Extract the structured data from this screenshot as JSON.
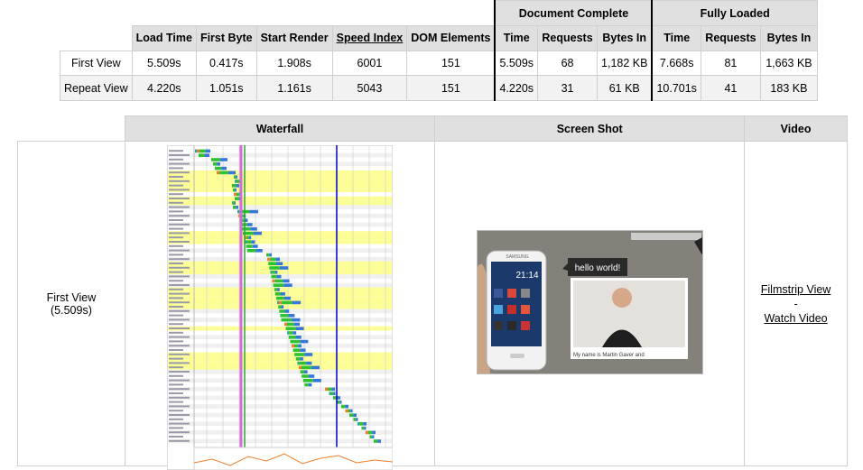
{
  "summary": {
    "groups": {
      "document_complete": "Document Complete",
      "fully_loaded": "Fully Loaded"
    },
    "headers": [
      "Load Time",
      "First Byte",
      "Start Render",
      "Speed Index",
      "DOM Elements",
      "Time",
      "Requests",
      "Bytes In",
      "Time",
      "Requests",
      "Bytes In"
    ],
    "rows": [
      {
        "label": "First View",
        "cells": [
          "5.509s",
          "0.417s",
          "1.908s",
          "6001",
          "151",
          "5.509s",
          "68",
          "1,182 KB",
          "7.668s",
          "81",
          "1,663 KB"
        ]
      },
      {
        "label": "Repeat View",
        "cells": [
          "4.220s",
          "1.051s",
          "1.161s",
          "5043",
          "151",
          "4.220s",
          "31",
          "61 KB",
          "10.701s",
          "41",
          "183 KB"
        ]
      }
    ]
  },
  "details": {
    "headers": {
      "waterfall": "Waterfall",
      "screenshot": "Screen Shot",
      "video": "Video"
    },
    "row_label": "First View",
    "row_sublabel": "(5.509s)",
    "filmstrip_link": "Filmstrip View",
    "separator": "-",
    "watch_video_link": "Watch Video"
  },
  "screenshot": {
    "speech_bubble": "hello world!",
    "caption": "My name is Martin Gaver and",
    "phone_time": "21:14",
    "phone_brand": "SAMSUNG"
  },
  "colors": {
    "header_bg": "#e0e0e0",
    "alt_row": "#f2f2f2",
    "highlight_row": "#fdfd96",
    "start_render_line": "#2aa52a",
    "doc_complete_line": "#0000cc",
    "dom_loaded_line": "#d66ad6",
    "dns": "#2aa5a5",
    "connect": "#f07f2a",
    "ttfb": "#2ec22e",
    "download": "#3578d8"
  }
}
